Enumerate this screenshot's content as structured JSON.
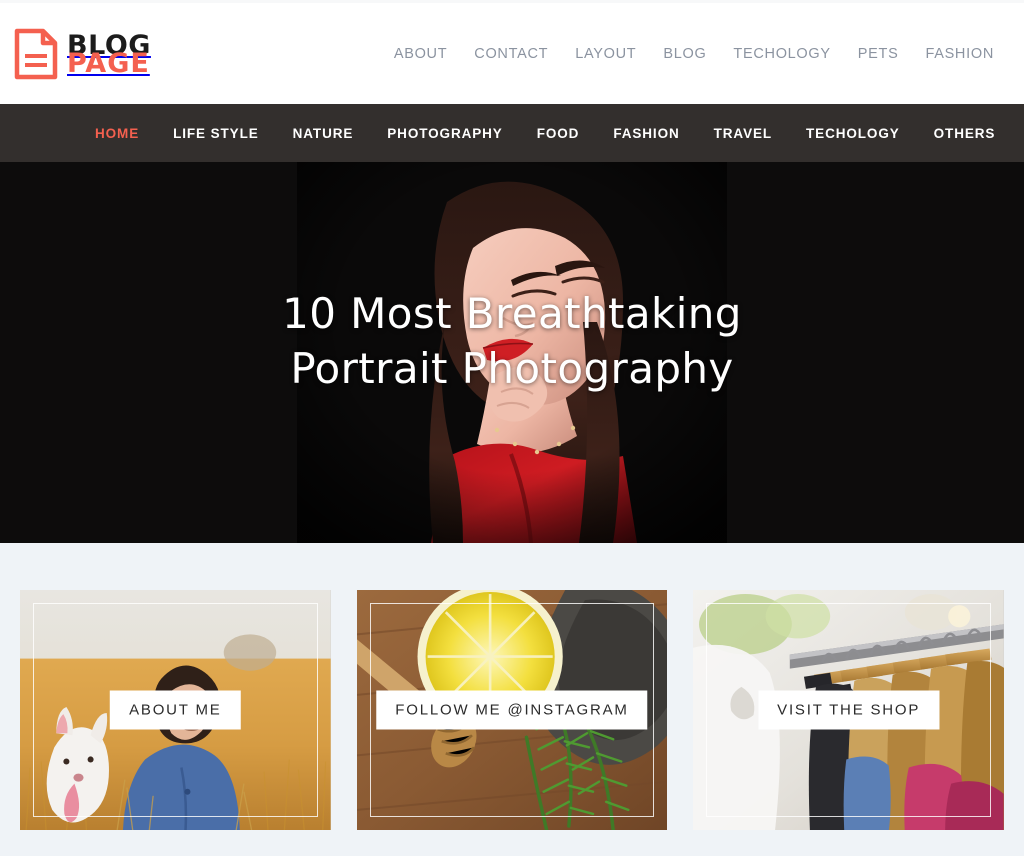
{
  "brand": {
    "icon": "document-icon",
    "line1": "BLOG",
    "line2": "PAGE",
    "color_primary": "#1c1c1c",
    "color_accent": "#f4604f"
  },
  "top_nav": {
    "items": [
      {
        "label": "ABOUT"
      },
      {
        "label": "CONTACT"
      },
      {
        "label": "LAYOUT"
      },
      {
        "label": "BLOG"
      },
      {
        "label": "TECHOLOGY"
      },
      {
        "label": "PETS"
      },
      {
        "label": "FASHION"
      }
    ]
  },
  "main_nav": {
    "background": "#332f2d",
    "active_color": "#f4604f",
    "items": [
      {
        "label": "HOME",
        "active": true
      },
      {
        "label": "LIFE STYLE",
        "active": false
      },
      {
        "label": "NATURE",
        "active": false
      },
      {
        "label": "PHOTOGRAPHY",
        "active": false
      },
      {
        "label": "FOOD",
        "active": false
      },
      {
        "label": "FASHION",
        "active": false
      },
      {
        "label": "TRAVEL",
        "active": false
      },
      {
        "label": "TECHOLOGY",
        "active": false
      },
      {
        "label": "OTHERS",
        "active": false
      }
    ],
    "search_icon": "search-icon"
  },
  "hero": {
    "title": "10 Most Breathtaking Portrait Photography",
    "title_line1": "10 Most Breathtaking",
    "title_line2": "Portrait Photography",
    "background": "#0d0c0c",
    "image_description": "portrait of woman with dark hair, red lipstick and red top on black background"
  },
  "promo": {
    "background": "#eff3f7",
    "cards": [
      {
        "label": "ABOUT ME",
        "image_description": "girl with white dog in a golden wheat field"
      },
      {
        "label": "FOLLOW ME @INSTAGRAM",
        "image_description": "lemon slice, honey dipper and rosemary on wooden table"
      },
      {
        "label": "VISIT THE SHOP",
        "image_description": "clothing rack with wooden hangers in a boutique"
      }
    ]
  }
}
